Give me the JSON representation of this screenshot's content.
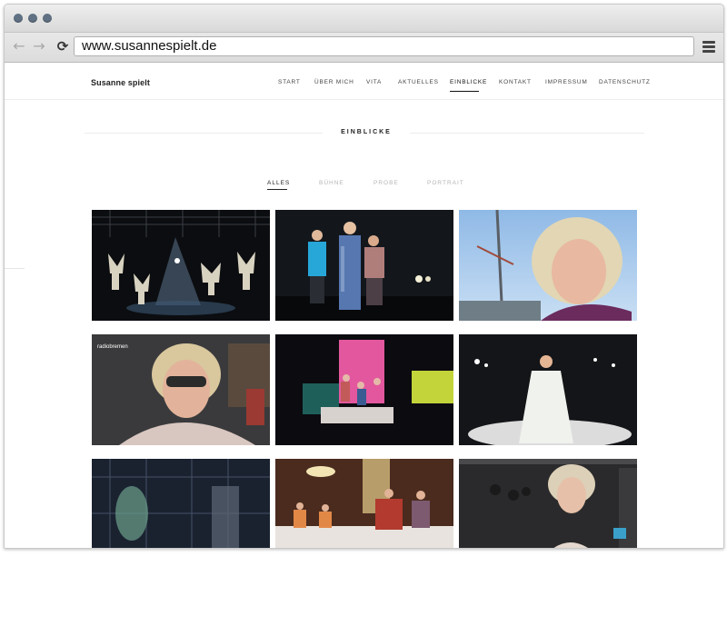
{
  "browser": {
    "url": "www.susannespielt.de",
    "back_glyph": "←",
    "forward_glyph": "→",
    "reload_glyph": "⟳"
  },
  "site": {
    "logo": "Susanne spielt",
    "nav": [
      {
        "label": "START"
      },
      {
        "label": "ÜBER MICH"
      },
      {
        "label": "VITA"
      },
      {
        "label": "AKTUELLES"
      },
      {
        "label": "EINBLICKE",
        "active": true
      },
      {
        "label": "KONTAKT"
      },
      {
        "label": "IMPRESSUM"
      },
      {
        "label": "DATENSCHUTZ"
      }
    ]
  },
  "section": {
    "title": "EINBLICKE"
  },
  "filters": [
    {
      "label": "ALLES",
      "active": true
    },
    {
      "label": "BÜHNE"
    },
    {
      "label": "PROBE"
    },
    {
      "label": "PORTRAIT"
    }
  ],
  "gallery": [
    {
      "name": "stage-angels",
      "label": ""
    },
    {
      "name": "three-actors",
      "label": ""
    },
    {
      "name": "portrait-outdoor",
      "label": ""
    },
    {
      "name": "tv-interview",
      "label": "radiobremen"
    },
    {
      "name": "pink-stage",
      "label": ""
    },
    {
      "name": "white-dress-stage",
      "label": ""
    },
    {
      "name": "rehearsal-scaffold",
      "label": ""
    },
    {
      "name": "royal-scene",
      "label": ""
    },
    {
      "name": "surprised-actress",
      "label": ""
    }
  ],
  "colors": {
    "accent": "#111111",
    "inactive_filter": "#b5b5b5",
    "window_dot": "#5f7183"
  }
}
